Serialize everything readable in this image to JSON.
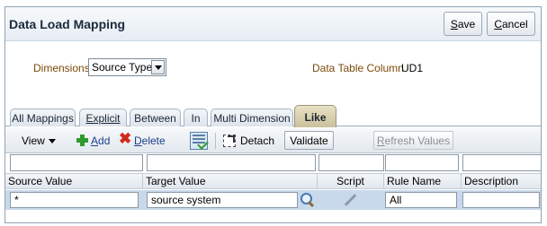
{
  "header": {
    "title": "Data Load Mapping",
    "save_label": "ave",
    "save_mnemonic": "S",
    "cancel_label": "ancel",
    "cancel_mnemonic": "C"
  },
  "dimensions": {
    "label": "Dimensions",
    "selected": "Source Type"
  },
  "data_table_column": {
    "label": "Data Table Column",
    "value": "UD1"
  },
  "tabs": [
    {
      "label": "All Mappings"
    },
    {
      "label": "Explicit"
    },
    {
      "label": "Between"
    },
    {
      "label": "In"
    },
    {
      "label": "Multi Dimension"
    },
    {
      "label": "Like",
      "active": true
    }
  ],
  "toolbar": {
    "view_label": "View",
    "add_label": "dd",
    "add_mnemonic": "A",
    "delete_label": "elete",
    "delete_mnemonic": "D",
    "detach_label": "Detach",
    "validate_label": "Validate",
    "refresh_label": "efresh Values",
    "refresh_prefix": "R"
  },
  "columns": [
    "Source Value",
    "Target Value",
    "Script",
    "Rule Name",
    "Description"
  ],
  "rows": [
    {
      "source_value": "*",
      "target_value": "source system",
      "rule_name": "All",
      "description": ""
    }
  ],
  "icons": {
    "add": "plus-icon",
    "delete": "x-icon",
    "grid": "grid-icon",
    "detach": "detach-icon",
    "search": "search-icon",
    "script": "pencil-icon"
  }
}
